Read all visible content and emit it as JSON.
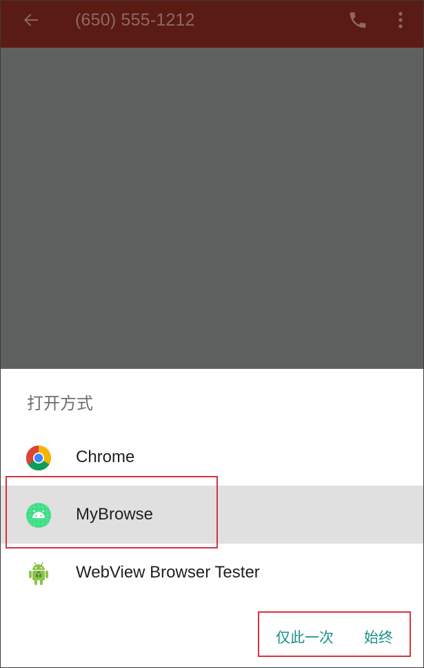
{
  "appbar": {
    "title": "(650) 555-1212",
    "back_icon": "arrow-back-icon",
    "phone_icon": "phone-icon",
    "more_icon": "more-vert-icon",
    "color": "#5b1b15"
  },
  "chooser": {
    "title": "打开方式",
    "apps": [
      {
        "label": "Chrome",
        "icon": "chrome-icon"
      },
      {
        "label": "MyBrowse",
        "icon": "android-app-icon"
      },
      {
        "label": "WebView Browser Tester",
        "icon": "android-robot-icon"
      }
    ],
    "selected_index": 1,
    "buttons": {
      "just_once": "仅此一次",
      "always": "始终"
    }
  },
  "accent_color": "#1a8f86",
  "annotation_color": "#d9323a"
}
